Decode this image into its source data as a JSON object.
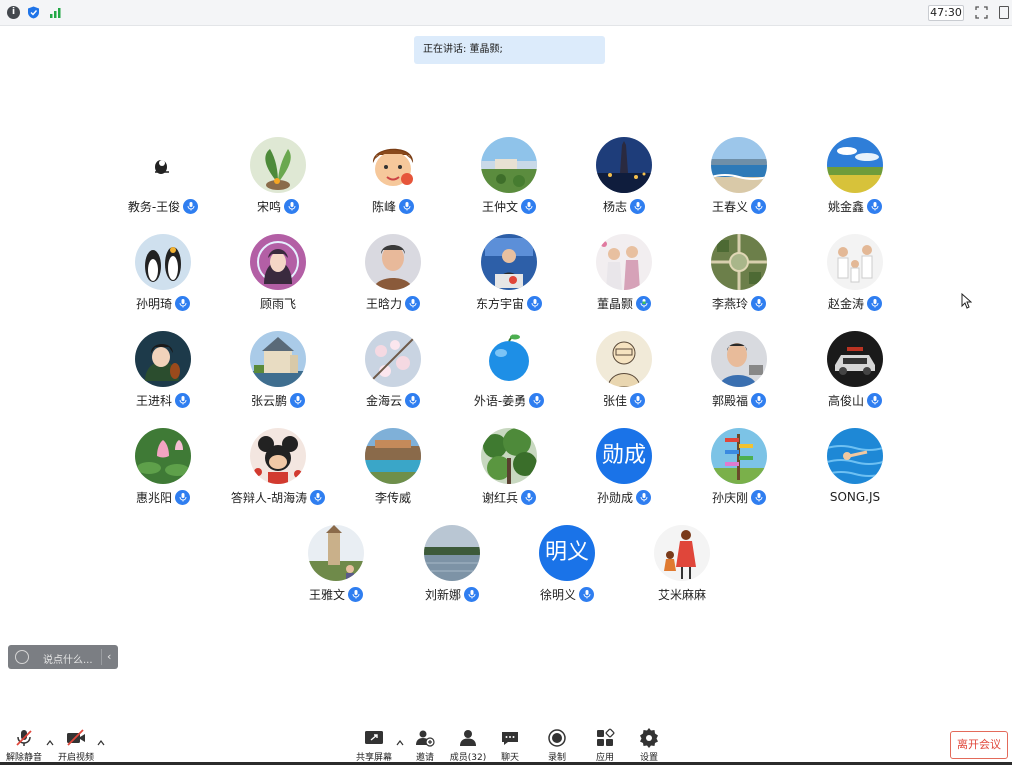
{
  "topbar": {
    "info_icon": "info-icon",
    "shield_icon": "shield-icon",
    "signal_icon": "signal-icon",
    "timer": "47:30",
    "fullscreen_icon": "fullscreen-icon",
    "window_icon": "window-icon"
  },
  "speaking_text": "正在讲话: 董晶颢;",
  "participants": [
    {
      "name": "教务-王俊",
      "mic": true,
      "avatar": "penguin-drawing"
    },
    {
      "name": "宋鸣",
      "mic": true,
      "avatar": "plant-photo"
    },
    {
      "name": "陈峰",
      "mic": true,
      "avatar": "cartoon-boy"
    },
    {
      "name": "王仲文",
      "mic": true,
      "avatar": "landscape-photo"
    },
    {
      "name": "杨志",
      "mic": true,
      "avatar": "city-night-photo"
    },
    {
      "name": "王春义",
      "mic": true,
      "avatar": "seaside-photo"
    },
    {
      "name": "姚金鑫",
      "mic": true,
      "avatar": "field-sky-photo"
    },
    {
      "name": "孙明琦",
      "mic": true,
      "avatar": "penguins-photo"
    },
    {
      "name": "顾雨飞",
      "mic": false,
      "avatar": "anime-girl"
    },
    {
      "name": "王晗力",
      "mic": true,
      "avatar": "portrait-photo"
    },
    {
      "name": "东方宇宙",
      "mic": true,
      "avatar": "speaker-photo"
    },
    {
      "name": "董晶颢",
      "mic": true,
      "avatar": "couple-photo",
      "speaking": true
    },
    {
      "name": "李燕玲",
      "mic": true,
      "avatar": "aerial-photo"
    },
    {
      "name": "赵金涛",
      "mic": true,
      "avatar": "family-photo"
    },
    {
      "name": "王进科",
      "mic": true,
      "avatar": "anime-violin"
    },
    {
      "name": "张云鹏",
      "mic": true,
      "avatar": "castle-photo"
    },
    {
      "name": "金海云",
      "mic": true,
      "avatar": "blossom-photo"
    },
    {
      "name": "外语-姜勇",
      "mic": true,
      "avatar": "blue-apple"
    },
    {
      "name": "张佳",
      "mic": true,
      "avatar": "sketch-drawing"
    },
    {
      "name": "郭殿福",
      "mic": true,
      "avatar": "man-photo"
    },
    {
      "name": "高俊山",
      "mic": true,
      "avatar": "car-photo"
    },
    {
      "name": "惠兆阳",
      "mic": true,
      "avatar": "lotus-photo"
    },
    {
      "name": "答辩人-胡海涛",
      "mic": true,
      "avatar": "mickey-drawing"
    },
    {
      "name": "李传威",
      "mic": false,
      "avatar": "resort-photo"
    },
    {
      "name": "谢红兵",
      "mic": true,
      "avatar": "trees-photo"
    },
    {
      "name": "孙勋成",
      "mic": true,
      "avatar": "text",
      "avatar_text": "勋成"
    },
    {
      "name": "孙庆刚",
      "mic": true,
      "avatar": "signpost-photo"
    },
    {
      "name": "SONG.JS",
      "mic": false,
      "avatar": "swimmer-photo"
    },
    {
      "name": "王雅文",
      "mic": true,
      "avatar": "tower-photo"
    },
    {
      "name": "刘新娜",
      "mic": true,
      "avatar": "lake-photo"
    },
    {
      "name": "徐明义",
      "mic": true,
      "avatar": "text",
      "avatar_text": "明义"
    },
    {
      "name": "艾米麻麻",
      "mic": false,
      "avatar": "cartoon-mother"
    }
  ],
  "chat": {
    "placeholder": "说点什么...",
    "emoji_icon": "emoji-icon",
    "collapse_icon": "‹"
  },
  "toolbar": {
    "unmute": "解除静音",
    "start_video": "开启视频",
    "share_screen": "共享屏幕",
    "invite": "邀请",
    "members": "成员(32)",
    "chat": "聊天",
    "record": "录制",
    "apps": "应用",
    "settings": "设置",
    "leave": "离开会议"
  },
  "colors": {
    "accent": "#2f7ef0",
    "avatar_text_bg": "#1a73e8",
    "speaking_bg": "#dcebfb",
    "leave": "#e0463a"
  }
}
